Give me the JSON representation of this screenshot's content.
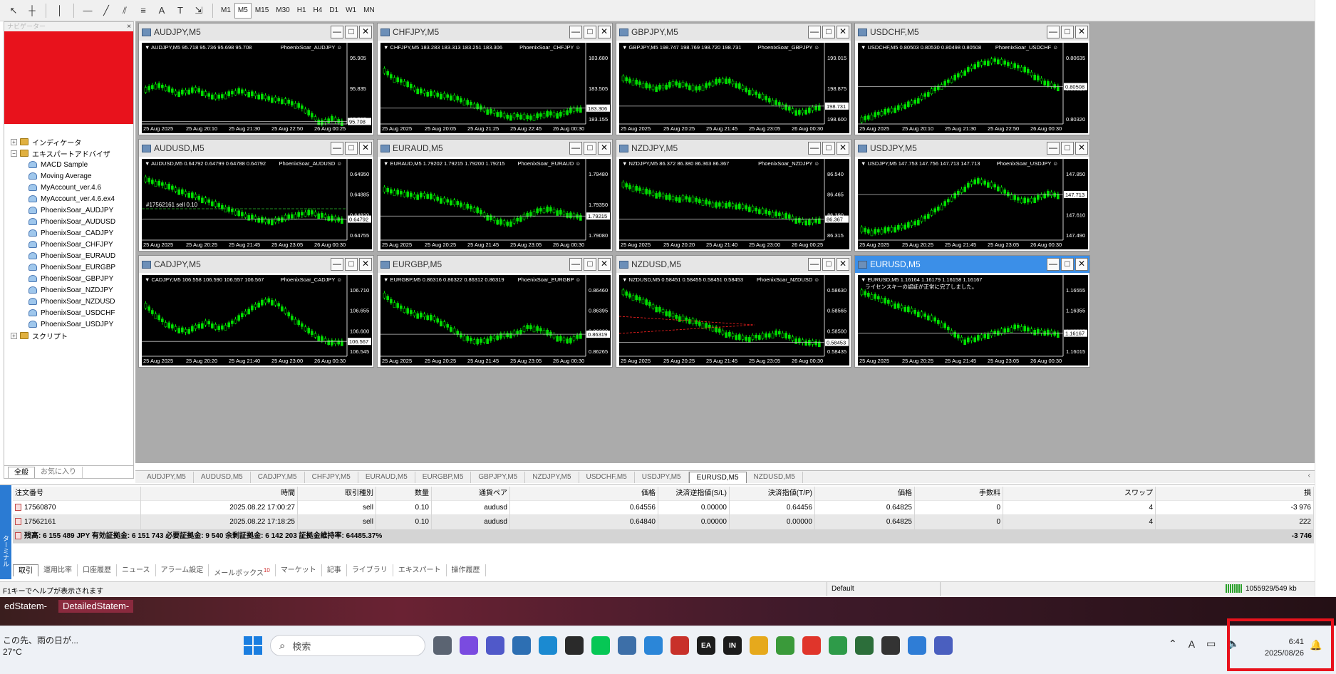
{
  "toolbar": {
    "timeframes": [
      "M1",
      "M5",
      "M15",
      "M30",
      "H1",
      "H4",
      "D1",
      "W1",
      "MN"
    ],
    "active_timeframe": "M5"
  },
  "navigator": {
    "tree": [
      {
        "label": "インディケータ",
        "indent": 1,
        "icon": "folder-icon",
        "expander": "+"
      },
      {
        "label": "エキスパートアドバイザ",
        "indent": 1,
        "icon": "folder-icon",
        "expander": "−"
      },
      {
        "label": "MACD Sample",
        "indent": 2,
        "icon": "expert-icon"
      },
      {
        "label": "Moving Average",
        "indent": 2,
        "icon": "expert-icon"
      },
      {
        "label": "MyAccount_ver.4.6",
        "indent": 2,
        "icon": "expert-icon"
      },
      {
        "label": "MyAccount_ver.4.6.ex4",
        "indent": 2,
        "icon": "expert-icon"
      },
      {
        "label": "PhoenixSoar_AUDJPY",
        "indent": 2,
        "icon": "expert-icon"
      },
      {
        "label": "PhoenixSoar_AUDUSD",
        "indent": 2,
        "icon": "expert-icon"
      },
      {
        "label": "PhoenixSoar_CADJPY",
        "indent": 2,
        "icon": "expert-icon"
      },
      {
        "label": "PhoenixSoar_CHFJPY",
        "indent": 2,
        "icon": "expert-icon"
      },
      {
        "label": "PhoenixSoar_EURAUD",
        "indent": 2,
        "icon": "expert-icon"
      },
      {
        "label": "PhoenixSoar_EURGBP",
        "indent": 2,
        "icon": "expert-icon"
      },
      {
        "label": "PhoenixSoar_GBPJPY",
        "indent": 2,
        "icon": "expert-icon"
      },
      {
        "label": "PhoenixSoar_NZDJPY",
        "indent": 2,
        "icon": "expert-icon"
      },
      {
        "label": "PhoenixSoar_NZDUSD",
        "indent": 2,
        "icon": "expert-icon"
      },
      {
        "label": "PhoenixSoar_USDCHF",
        "indent": 2,
        "icon": "expert-icon"
      },
      {
        "label": "PhoenixSoar_USDJPY",
        "indent": 2,
        "icon": "expert-icon"
      },
      {
        "label": "スクリプト",
        "indent": 1,
        "icon": "folder-icon",
        "expander": "+"
      }
    ],
    "tabs": [
      "全般",
      "お気に入り"
    ]
  },
  "charts": [
    {
      "title": "AUDJPY,M5",
      "ohlc": "AUDJPY,M5  95.718 95.736 95.698 95.708",
      "ea": "PhoenixSoar_AUDJPY",
      "prices": [
        "95.905",
        "95.835",
        "95.765"
      ],
      "current": "95.708",
      "times": [
        "25 Aug 2025",
        "25 Aug 20:10",
        "25 Aug 21:30",
        "25 Aug 22:50",
        "26 Aug 00:25"
      ],
      "path": [
        72,
        62,
        68,
        78,
        75,
        70,
        82,
        86,
        80,
        74,
        78,
        84,
        88,
        92,
        96,
        104,
        120,
        136,
        128,
        134
      ],
      "order_label": ""
    },
    {
      "title": "CHFJPY,M5",
      "ohlc": "CHFJPY,M5  183.283 183.313 183.251 183.306",
      "ea": "PhoenixSoar_CHFJPY",
      "prices": [
        "183.680",
        "183.505",
        "183.155"
      ],
      "current": "183.306",
      "times": [
        "25 Aug 2025",
        "25 Aug 20:05",
        "25 Aug 21:25",
        "25 Aug 22:45",
        "26 Aug 00:30"
      ],
      "path": [
        35,
        50,
        58,
        70,
        78,
        80,
        84,
        88,
        96,
        104,
        112,
        118,
        124,
        122,
        126,
        122,
        118,
        120,
        112,
        108
      ],
      "order_label": ""
    },
    {
      "title": "GBPJPY,M5",
      "ohlc": "GBPJPY,M5  198.747 198.769 198.720 198.731",
      "ea": "PhoenixSoar_GBPJPY",
      "prices": [
        "199.015",
        "198.875",
        "198.600"
      ],
      "current": "198.731",
      "times": [
        "25 Aug 2025",
        "25 Aug 20:25",
        "25 Aug 21:45",
        "25 Aug 23:05",
        "26 Aug 00:30"
      ],
      "path": [
        50,
        55,
        62,
        68,
        66,
        58,
        62,
        70,
        64,
        56,
        52,
        62,
        72,
        80,
        90,
        98,
        108,
        116,
        112,
        104
      ],
      "order_label": ""
    },
    {
      "title": "USDCHF,M5",
      "ohlc": "USDCHF,M5  0.80503 0.80530 0.80498 0.80508",
      "ea": "PhoenixSoar_USDCHF",
      "prices": [
        "0.80635",
        "0.80525",
        "0.80320"
      ],
      "current": "0.80508",
      "times": [
        "25 Aug 2025",
        "25 Aug 20:10",
        "25 Aug 21:30",
        "25 Aug 22:50",
        "26 Aug 00:30"
      ],
      "path": [
        130,
        122,
        116,
        110,
        104,
        96,
        84,
        72,
        60,
        48,
        36,
        24,
        18,
        14,
        20,
        26,
        34,
        48,
        60,
        66
      ],
      "order_label": ""
    },
    {
      "title": "AUDUSD,M5",
      "ohlc": "AUDUSD,M5  0.64792 0.64799 0.64788 0.64792",
      "ea": "PhoenixSoar_AUDUSD",
      "prices": [
        "0.64950",
        "0.64885",
        "0.64820",
        "0.64755"
      ],
      "current": "0.64792",
      "times": [
        "25 Aug 2025",
        "25 Aug 20:25",
        "25 Aug 21:45",
        "25 Aug 23:05",
        "26 Aug 00:30"
      ],
      "path": [
        20,
        26,
        32,
        40,
        48,
        54,
        62,
        70,
        78,
        86,
        92,
        98,
        102,
        98,
        92,
        88,
        84,
        90,
        96,
        98
      ],
      "order_label": "#17562161 sell 0.10"
    },
    {
      "title": "EURAUD,M5",
      "ohlc": "EURAUD,M5  1.79202 1.79215 1.79200 1.79215",
      "ea": "PhoenixSoar_EURAUD",
      "prices": [
        "1.79480",
        "1.79350",
        "1.79080"
      ],
      "current": "1.79215",
      "times": [
        "25 Aug 2025",
        "25 Aug 20:25",
        "25 Aug 21:45",
        "25 Aug 23:05",
        "26 Aug 00:30"
      ],
      "path": [
        40,
        44,
        48,
        52,
        50,
        56,
        62,
        66,
        72,
        80,
        92,
        102,
        106,
        98,
        88,
        80,
        78,
        84,
        90,
        92
      ],
      "order_label": ""
    },
    {
      "title": "NZDJPY,M5",
      "ohlc": "NZDJPY,M5  86.372 86.380 86.363 86.367",
      "ea": "PhoenixSoar_NZDJPY",
      "prices": [
        "86.540",
        "86.465",
        "86.390",
        "86.315"
      ],
      "current": "86.367",
      "times": [
        "25 Aug 2025",
        "25 Aug 20:20",
        "25 Aug 21:40",
        "25 Aug 23:00",
        "26 Aug 00:25"
      ],
      "path": [
        30,
        36,
        42,
        48,
        52,
        58,
        56,
        60,
        64,
        70,
        68,
        72,
        74,
        80,
        84,
        88,
        92,
        100,
        104,
        98
      ],
      "order_label": ""
    },
    {
      "title": "USDJPY,M5",
      "ohlc": "USDJPY,M5  147.753 147.756 147.713 147.713",
      "ea": "PhoenixSoar_USDJPY",
      "prices": [
        "147.850",
        "147.713",
        "147.610",
        "147.490"
      ],
      "current": "147.713",
      "times": [
        "25 Aug 2025",
        "25 Aug 20:25",
        "25 Aug 21:45",
        "25 Aug 23:05",
        "26 Aug 00:30"
      ],
      "path": [
        118,
        122,
        120,
        116,
        112,
        106,
        96,
        82,
        68,
        52,
        36,
        22,
        26,
        34,
        46,
        58,
        62,
        56,
        48,
        50
      ],
      "order_label": ""
    },
    {
      "title": "CADJPY,M5",
      "ohlc": "CADJPY,M5  106.558 106.590 106.557 106.567",
      "ea": "PhoenixSoar_CADJPY",
      "prices": [
        "106.710",
        "106.655",
        "106.600",
        "106.545"
      ],
      "current": "106.567",
      "times": [
        "25 Aug 2025",
        "25 Aug 20:20",
        "25 Aug 21:40",
        "25 Aug 23:00",
        "26 Aug 00:30"
      ],
      "path": [
        40,
        58,
        76,
        84,
        90,
        80,
        72,
        84,
        78,
        64,
        48,
        36,
        28,
        40,
        60,
        76,
        92,
        104,
        112,
        110
      ],
      "order_label": ""
    },
    {
      "title": "EURGBP,M5",
      "ohlc": "EURGBP,M5  0.86316 0.86322 0.86312 0.86319",
      "ea": "PhoenixSoar_EURGBP",
      "prices": [
        "0.86460",
        "0.86395",
        "0.86330",
        "0.86265"
      ],
      "current": "0.86319",
      "times": [
        "25 Aug 2025",
        "25 Aug 20:25",
        "25 Aug 21:45",
        "25 Aug 23:05",
        "26 Aug 00:30"
      ],
      "path": [
        20,
        36,
        48,
        56,
        60,
        66,
        78,
        92,
        104,
        110,
        106,
        100,
        96,
        92,
        80,
        86,
        94,
        104,
        108,
        96
      ],
      "order_label": ""
    },
    {
      "title": "NZDUSD,M5",
      "ohlc": "NZDUSD,M5  0.58451 0.58455 0.58451 0.58453",
      "ea": "PhoenixSoar_NZDUSD",
      "prices": [
        "0.58630",
        "0.58565",
        "0.58500",
        "0.58435"
      ],
      "current": "0.58453",
      "times": [
        "25 Aug 2025",
        "25 Aug 20:25",
        "25 Aug 21:45",
        "25 Aug 23:05",
        "26 Aug 00:30"
      ],
      "path": [
        14,
        22,
        30,
        42,
        52,
        60,
        66,
        72,
        78,
        86,
        94,
        100,
        104,
        100,
        98,
        92,
        100,
        108,
        112,
        112
      ],
      "order_label": ""
    },
    {
      "title": "EURUSD,M5",
      "ohlc": "EURUSD,M5  1.16164 1.16179 1.16158 1.16167",
      "ea": "",
      "note": "ライセンスキーの認証が正常に完了しました。",
      "prices": [
        "1.16555",
        "1.16355",
        "1.16225",
        "1.16015"
      ],
      "current": "1.16167",
      "times": [
        "25 Aug 2025",
        "25 Aug 20:25",
        "25 Aug 21:45",
        "25 Aug 23:05",
        "26 Aug 00:30"
      ],
      "path": [
        14,
        20,
        28,
        36,
        44,
        50,
        58,
        66,
        78,
        96,
        108,
        104,
        98,
        92,
        88,
        80,
        86,
        90,
        92,
        94
      ],
      "order_label": ""
    }
  ],
  "symbol_tabs": [
    "AUDJPY,M5",
    "AUDUSD,M5",
    "CADJPY,M5",
    "CHFJPY,M5",
    "EURAUD,M5",
    "EURGBP,M5",
    "GBPJPY,M5",
    "NZDJPY,M5",
    "USDCHF,M5",
    "USDJPY,M5",
    "EURUSD,M5",
    "NZDUSD,M5"
  ],
  "active_symbol_tab": "EURUSD,M5",
  "terminal": {
    "side_label": "ターミナル",
    "headers": [
      "注文番号",
      "時間",
      "取引種別",
      "数量",
      "通貨ペア",
      "価格",
      "決済逆指値(S/L)",
      "決済指値(T/P)",
      "価格",
      "手数料",
      "スワップ",
      "損"
    ],
    "orders": [
      {
        "ticket": "17560870",
        "time": "2025.08.22 17:00:27",
        "type": "sell",
        "volume": "0.10",
        "symbol": "audusd",
        "price": "0.64556",
        "sl": "0.00000",
        "tp": "0.64456",
        "current": "0.64825",
        "commission": "0",
        "swap": "4",
        "profit": "-3 976"
      },
      {
        "ticket": "17562161",
        "time": "2025.08.22 17:18:25",
        "type": "sell",
        "volume": "0.10",
        "symbol": "audusd",
        "price": "0.64840",
        "sl": "0.00000",
        "tp": "0.00000",
        "current": "0.64825",
        "commission": "0",
        "swap": "4",
        "profit": "222"
      }
    ],
    "balance_line": "残高: 6 155 489 JPY  有効証拠金: 6 151 743  必要証拠金: 9 540  余剰証拠金: 6 142 203  証拠金維持率: 64485.37%",
    "balance_profit": "-3 746",
    "tabs": [
      "取引",
      "運用比率",
      "口座履歴",
      "ニュース",
      "アラーム設定",
      "メールボックス",
      "マーケット",
      "記事",
      "ライブラリ",
      "エキスパート",
      "操作履歴"
    ],
    "mailbox_badge": "10"
  },
  "statusbar": {
    "help": "F1キーでヘルプが表示されます",
    "profile": "Default",
    "connection": "1055929/549 kb"
  },
  "background_tabs": [
    "edStatem-",
    "DetailedStatem-"
  ],
  "taskbar": {
    "weather_line1": "この先、雨の日が...",
    "weather_line2": "27°C",
    "search_placeholder": "検索",
    "apps": [
      {
        "name": "task-view-icon",
        "label": "",
        "color": "#5b6472"
      },
      {
        "name": "copilot-icon",
        "label": "",
        "color": "#7a4be0"
      },
      {
        "name": "teams-icon",
        "label": "",
        "color": "#5059c9"
      },
      {
        "name": "remote-icon",
        "label": "",
        "color": "#2d6fb3"
      },
      {
        "name": "edge-icon",
        "label": "",
        "color": "#1b8ad1"
      },
      {
        "name": "alpari-icon",
        "label": "",
        "color": "#2a2a2a"
      },
      {
        "name": "line-icon",
        "label": "",
        "color": "#06c755"
      },
      {
        "name": "calculator-icon",
        "label": "",
        "color": "#3d6fa8"
      },
      {
        "name": "notepad-icon",
        "label": "",
        "color": "#2b86d8"
      },
      {
        "name": "snipping-icon",
        "label": "",
        "color": "#c8312a"
      },
      {
        "name": "ea-icon",
        "label": "EA",
        "color": "#1c1c1c"
      },
      {
        "name": "in-icon",
        "label": "IN",
        "color": "#1c1c1c"
      },
      {
        "name": "explorer-icon",
        "label": "",
        "color": "#e6a91c"
      },
      {
        "name": "shield-app-icon",
        "label": "",
        "color": "#3a9a3a"
      },
      {
        "name": "anydesk-icon",
        "label": "",
        "color": "#e0352b"
      },
      {
        "name": "chrome-icon",
        "label": "",
        "color": "#2e9b49"
      },
      {
        "name": "mt4-icon",
        "label": "",
        "color": "#2c6e3a"
      },
      {
        "name": "wifi-app-icon",
        "label": "",
        "color": "#333333"
      },
      {
        "name": "paint-icon",
        "label": "",
        "color": "#2f7dd6"
      },
      {
        "name": "network-app-icon",
        "label": "",
        "color": "#4a5fbf"
      }
    ]
  },
  "tray": {
    "ime": "A",
    "time": "6:41",
    "date": "2025/08/26"
  }
}
